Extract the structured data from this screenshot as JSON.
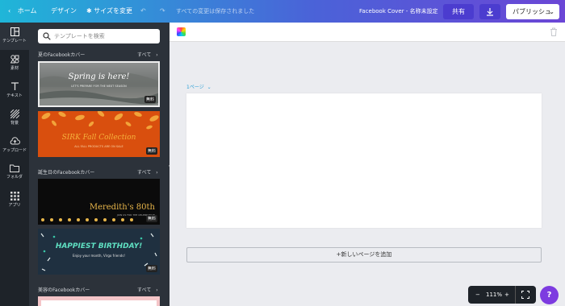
{
  "topbar": {
    "home": "ホーム",
    "design": "デザイン",
    "resize": "サイズを変更",
    "saved_status": "すべての変更は保存されました",
    "doc_title": "Facebook Cover - 名称未設定",
    "share": "共有",
    "publish": "パブリッシュ"
  },
  "leftnav": {
    "templates": "テンプレート",
    "elements": "素材",
    "text": "テキスト",
    "background": "背景",
    "uploads": "アップロード",
    "folders": "フォルダ",
    "apps": "アプリ"
  },
  "panel": {
    "search_placeholder": "テンプレートを検索",
    "sections": [
      {
        "title": "夏のFacebookカバー",
        "all": "すべて"
      },
      {
        "title": "誕生日のFacebookカバー",
        "all": "すべて"
      },
      {
        "title": "美容のFacebookカバー",
        "all": "すべて"
      }
    ],
    "thumbs": [
      {
        "text": "Spring is here!",
        "sub": "LET'S PREPARE FOR THE NEXT SEASON",
        "badge": "無料"
      },
      {
        "text": "SIRK Fall Collection",
        "sub": "ALL FALL PRODUCTS ARE ON SALE",
        "badge": "無料"
      },
      {
        "text": "Meredith's 80th",
        "sub": "JOIN US FOR THE CELEBRATION",
        "badge": "無料"
      },
      {
        "text": "HAPPIEST BIRTHDAY!",
        "sub": "Enjoy your month, Virgo friends!",
        "badge": "無料"
      }
    ]
  },
  "canvas": {
    "page_label": "1ページ",
    "add_page": "+新しいページを追加",
    "zoom": "111%"
  },
  "help": "?"
}
